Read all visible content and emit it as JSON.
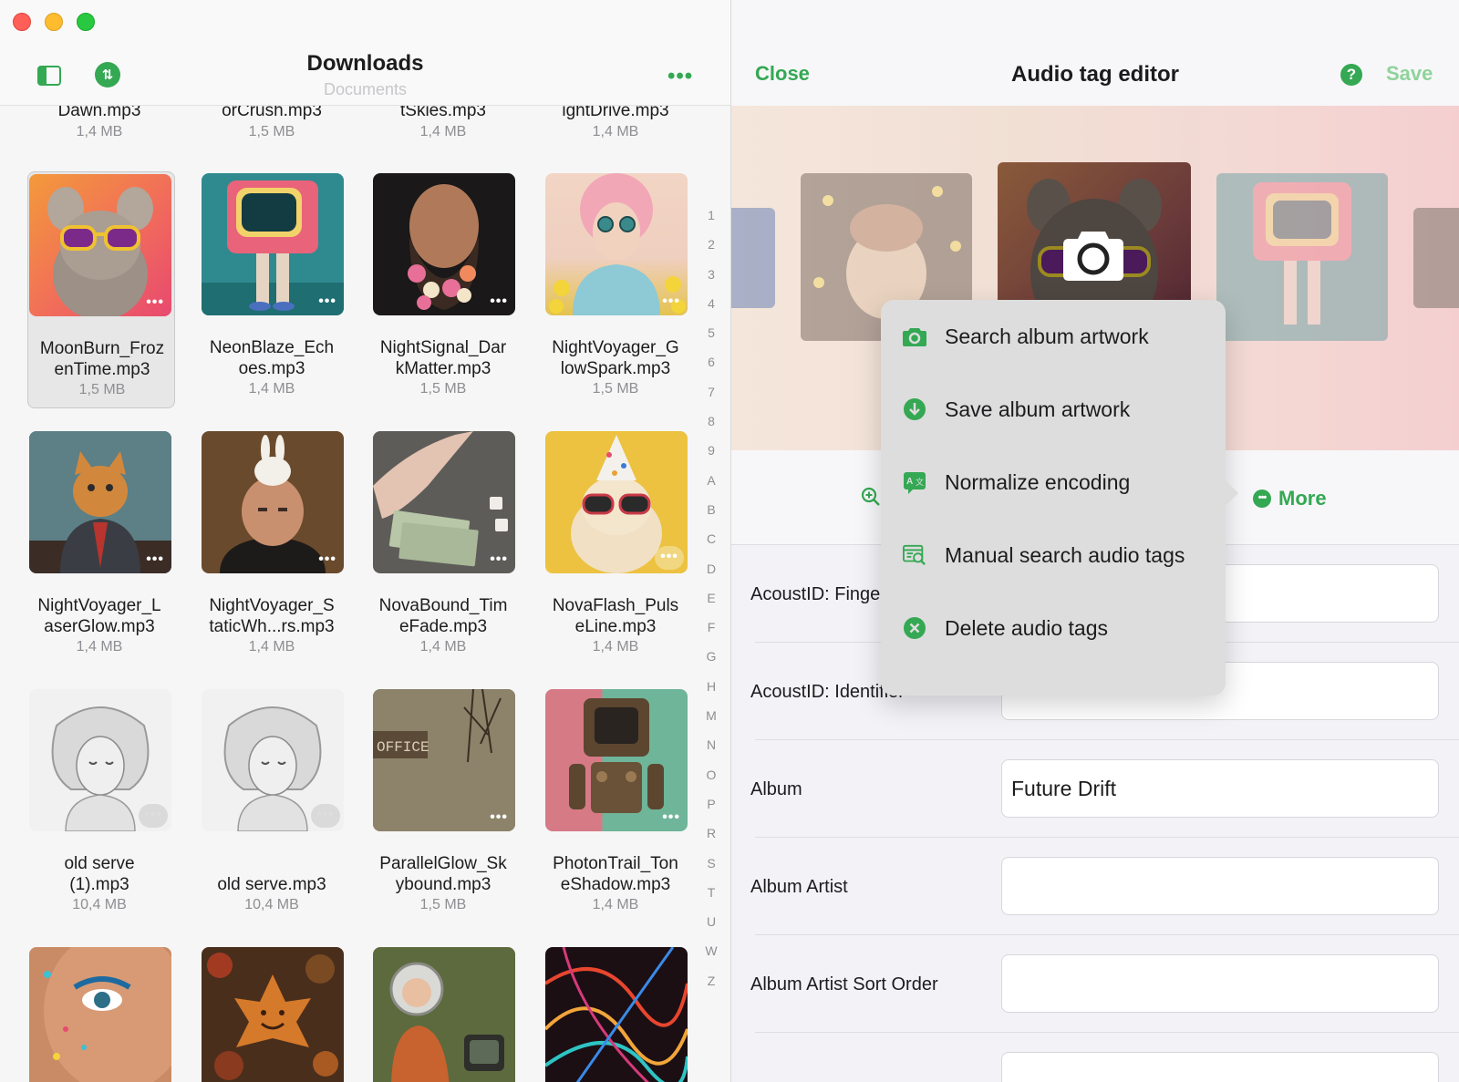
{
  "window": {
    "title": "Downloads",
    "subtitle": "Documents"
  },
  "colors": {
    "accent": "#34a853",
    "accent_disabled": "#8fd39a"
  },
  "top_partial_files": [
    {
      "name": "Dawn.mp3",
      "size": "1,4 MB"
    },
    {
      "name": "orCrush.mp3",
      "size": "1,5 MB"
    },
    {
      "name": "tSkies.mp3",
      "size": "1,4 MB"
    },
    {
      "name": "ightDrive.mp3",
      "size": "1,4 MB"
    }
  ],
  "files": [
    {
      "line1": "MoonBurn_Froz",
      "line2": "enTime.mp3",
      "size": "1,5 MB",
      "selected": true
    },
    {
      "line1": "NeonBlaze_Ech",
      "line2": "oes.mp3",
      "size": "1,4 MB"
    },
    {
      "line1": "NightSignal_Dar",
      "line2": "kMatter.mp3",
      "size": "1,5 MB"
    },
    {
      "line1": "NightVoyager_G",
      "line2": "lowSpark.mp3",
      "size": "1,5 MB"
    },
    {
      "line1": "NightVoyager_L",
      "line2": "aserGlow.mp3",
      "size": "1,4 MB"
    },
    {
      "line1": "NightVoyager_S",
      "line2": "taticWh...rs.mp3",
      "size": "1,4 MB"
    },
    {
      "line1": "NovaBound_Tim",
      "line2": "eFade.mp3",
      "size": "1,4 MB"
    },
    {
      "line1": "NovaFlash_Puls",
      "line2": "eLine.mp3",
      "size": "1,4 MB"
    },
    {
      "line1": "old serve",
      "line2": "(1).mp3",
      "size": "10,4 MB"
    },
    {
      "line1": "",
      "line2": "old serve.mp3",
      "size": "10,4 MB"
    },
    {
      "line1": "ParallelGlow_Sk",
      "line2": "ybound.mp3",
      "size": "1,5 MB"
    },
    {
      "line1": "PhotonTrail_Ton",
      "line2": "eShadow.mp3",
      "size": "1,4 MB"
    }
  ],
  "index_letters": [
    "1",
    "2",
    "3",
    "4",
    "5",
    "6",
    "7",
    "8",
    "9",
    "A",
    "B",
    "C",
    "D",
    "E",
    "F",
    "G",
    "H",
    "M",
    "N",
    "O",
    "P",
    "R",
    "S",
    "T",
    "U",
    "W",
    "Z"
  ],
  "editor": {
    "close_label": "Close",
    "title": "Audio tag editor",
    "help_icon": "question-icon",
    "save_label": "Save",
    "more_label": "More"
  },
  "menu": [
    {
      "label": "Search album artwork",
      "icon": "camera-icon"
    },
    {
      "label": "Save album artwork",
      "icon": "download-icon"
    },
    {
      "label": "Normalize encoding",
      "icon": "translate-icon"
    },
    {
      "label": "Manual search audio tags",
      "icon": "list-search-icon"
    },
    {
      "label": "Delete audio tags",
      "icon": "x-circle-icon"
    }
  ],
  "fields": [
    {
      "label": "AcoustID: Finge",
      "value": ""
    },
    {
      "label": "AcoustID: Identifier",
      "value": ""
    },
    {
      "label": "Album",
      "value": "Future Drift"
    },
    {
      "label": "Album Artist",
      "value": ""
    },
    {
      "label": "Album Artist Sort Order",
      "value": ""
    },
    {
      "label": "",
      "value": ""
    }
  ]
}
